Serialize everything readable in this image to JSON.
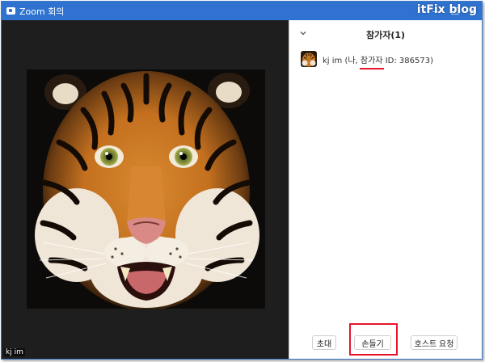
{
  "window": {
    "title": "Zoom 회의",
    "watermark": "itFix blog",
    "minimize_symbol": "—",
    "maximize_symbol": "☐",
    "close_symbol": "✕"
  },
  "video": {
    "participant_name": "kj im",
    "image_subject": "tiger"
  },
  "panel": {
    "title": "참가자(1)",
    "collapse_icon": "chevron-down-icon"
  },
  "participants": [
    {
      "name_prefix": "kj im (나, ",
      "role": "참가자",
      "suffix": " ID: 386573)"
    }
  ],
  "footer": {
    "invite_label": "초대",
    "raise_hand_label": "손들기",
    "request_host_label": "호스트 요청"
  },
  "colors": {
    "title_bar": "#2f72d0",
    "highlight": "#e8152a",
    "video_bg": "#1e1e1e"
  }
}
